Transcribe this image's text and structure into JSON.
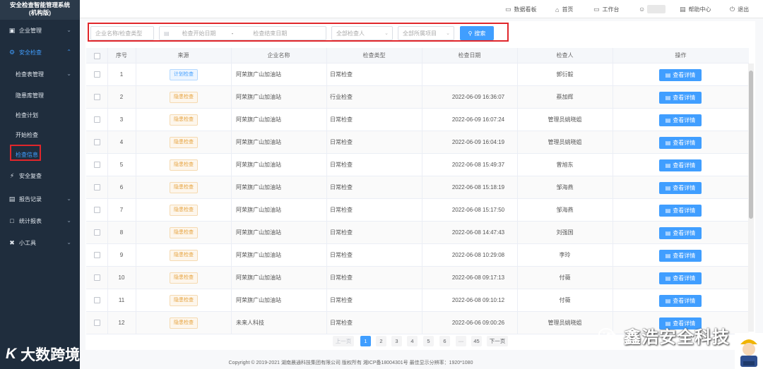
{
  "sidebar": {
    "title_line1": "安全检查智能管理系统",
    "title_line2": "(机构版)",
    "items": [
      {
        "label": "企业管理",
        "icon": "building-icon"
      },
      {
        "label": "安全检查",
        "icon": "shield-check-icon"
      },
      {
        "label": "安全复查",
        "icon": "lightning-icon"
      },
      {
        "label": "报告记录",
        "icon": "clipboard-icon"
      },
      {
        "label": "统计报表",
        "icon": "folder-icon"
      },
      {
        "label": "小工具",
        "icon": "tools-icon"
      }
    ],
    "sub_items": [
      {
        "label": "检查表管理"
      },
      {
        "label": "隐患库管理"
      },
      {
        "label": "检查计划"
      },
      {
        "label": "开始检查"
      },
      {
        "label": "检查信息"
      }
    ]
  },
  "topbar": {
    "dashboard": "数据看板",
    "home": "首页",
    "workbench": "工作台",
    "help": "帮助中心",
    "logout": "退出"
  },
  "search": {
    "company_placeholder": "企业名称/检查类型",
    "start_date_placeholder": "检查开始日期",
    "range_sep": "-",
    "end_date_placeholder": "检查结束日期",
    "inspector_placeholder": "全部检查人",
    "project_placeholder": "全部所属项目",
    "search_label": "搜索"
  },
  "table": {
    "headers": [
      "序号",
      "来源",
      "企业名称",
      "检查类型",
      "检查日期",
      "检查人",
      "操作"
    ],
    "detail_label": "查看详情",
    "rows": [
      {
        "no": "1",
        "source": "计划检查",
        "source_type": "plan",
        "company": "阿荣旗广山加油站",
        "type": "日常检查",
        "date": "",
        "inspector": "郭衍毅"
      },
      {
        "no": "2",
        "source": "隐患检查",
        "source_type": "hazard",
        "company": "阿荣旗广山加油站",
        "type": "行业检查",
        "date": "2022-06-09 16:36:07",
        "inspector": "蔡加辉"
      },
      {
        "no": "3",
        "source": "隐患检查",
        "source_type": "hazard",
        "company": "阿荣旗广山加油站",
        "type": "日常检查",
        "date": "2022-06-09 16:07:24",
        "inspector": "管理员姚晓姐"
      },
      {
        "no": "4",
        "source": "隐患检查",
        "source_type": "hazard",
        "company": "阿荣旗广山加油站",
        "type": "日常检查",
        "date": "2022-06-09 16:04:19",
        "inspector": "管理员姚晓姐"
      },
      {
        "no": "5",
        "source": "隐患检查",
        "source_type": "hazard",
        "company": "阿荣旗广山加油站",
        "type": "日常检查",
        "date": "2022-06-08 15:49:37",
        "inspector": "曾旭东"
      },
      {
        "no": "6",
        "source": "隐患检查",
        "source_type": "hazard",
        "company": "阿荣旗广山加油站",
        "type": "日常检查",
        "date": "2022-06-08 15:18:19",
        "inspector": "邹海燕"
      },
      {
        "no": "7",
        "source": "隐患检查",
        "source_type": "hazard",
        "company": "阿荣旗广山加油站",
        "type": "日常检查",
        "date": "2022-06-08 15:17:50",
        "inspector": "邹海燕"
      },
      {
        "no": "8",
        "source": "隐患检查",
        "source_type": "hazard",
        "company": "阿荣旗广山加油站",
        "type": "日常检查",
        "date": "2022-06-08 14:47:43",
        "inspector": "刘强国"
      },
      {
        "no": "9",
        "source": "隐患检查",
        "source_type": "hazard",
        "company": "阿荣旗广山加油站",
        "type": "日常检查",
        "date": "2022-06-08 10:29:08",
        "inspector": "李玲"
      },
      {
        "no": "10",
        "source": "隐患检查",
        "source_type": "hazard",
        "company": "阿荣旗广山加油站",
        "type": "日常检查",
        "date": "2022-06-08 09:17:13",
        "inspector": "付薇"
      },
      {
        "no": "11",
        "source": "隐患检查",
        "source_type": "hazard",
        "company": "阿荣旗广山加油站",
        "type": "日常检查",
        "date": "2022-06-08 09:10:12",
        "inspector": "付薇"
      },
      {
        "no": "12",
        "source": "隐患检查",
        "source_type": "hazard",
        "company": "未来人科技",
        "type": "日常检查",
        "date": "2022-06-06 09:00:26",
        "inspector": "管理员姚晓姐"
      }
    ]
  },
  "pagination": {
    "prev": "上一页",
    "pages": [
      "1",
      "2",
      "3",
      "4",
      "5",
      "6",
      "···",
      "45"
    ],
    "current": "1",
    "next": "下一页"
  },
  "footer": "Copyright © 2019-2021 湖南晨通科技集团有限公司 版权所有 湘ICP备18004301号 最佳显示分辨率：1920*1080",
  "watermarks": {
    "left_logo": "K",
    "left_text": "大数跨境",
    "right_text": "鑫浩安全科技"
  },
  "colors": {
    "accent": "#409eff",
    "sidebar_bg": "#1f2d3d",
    "highlight_border": "#e0262b",
    "hazard_tag": "#e6a23c"
  }
}
